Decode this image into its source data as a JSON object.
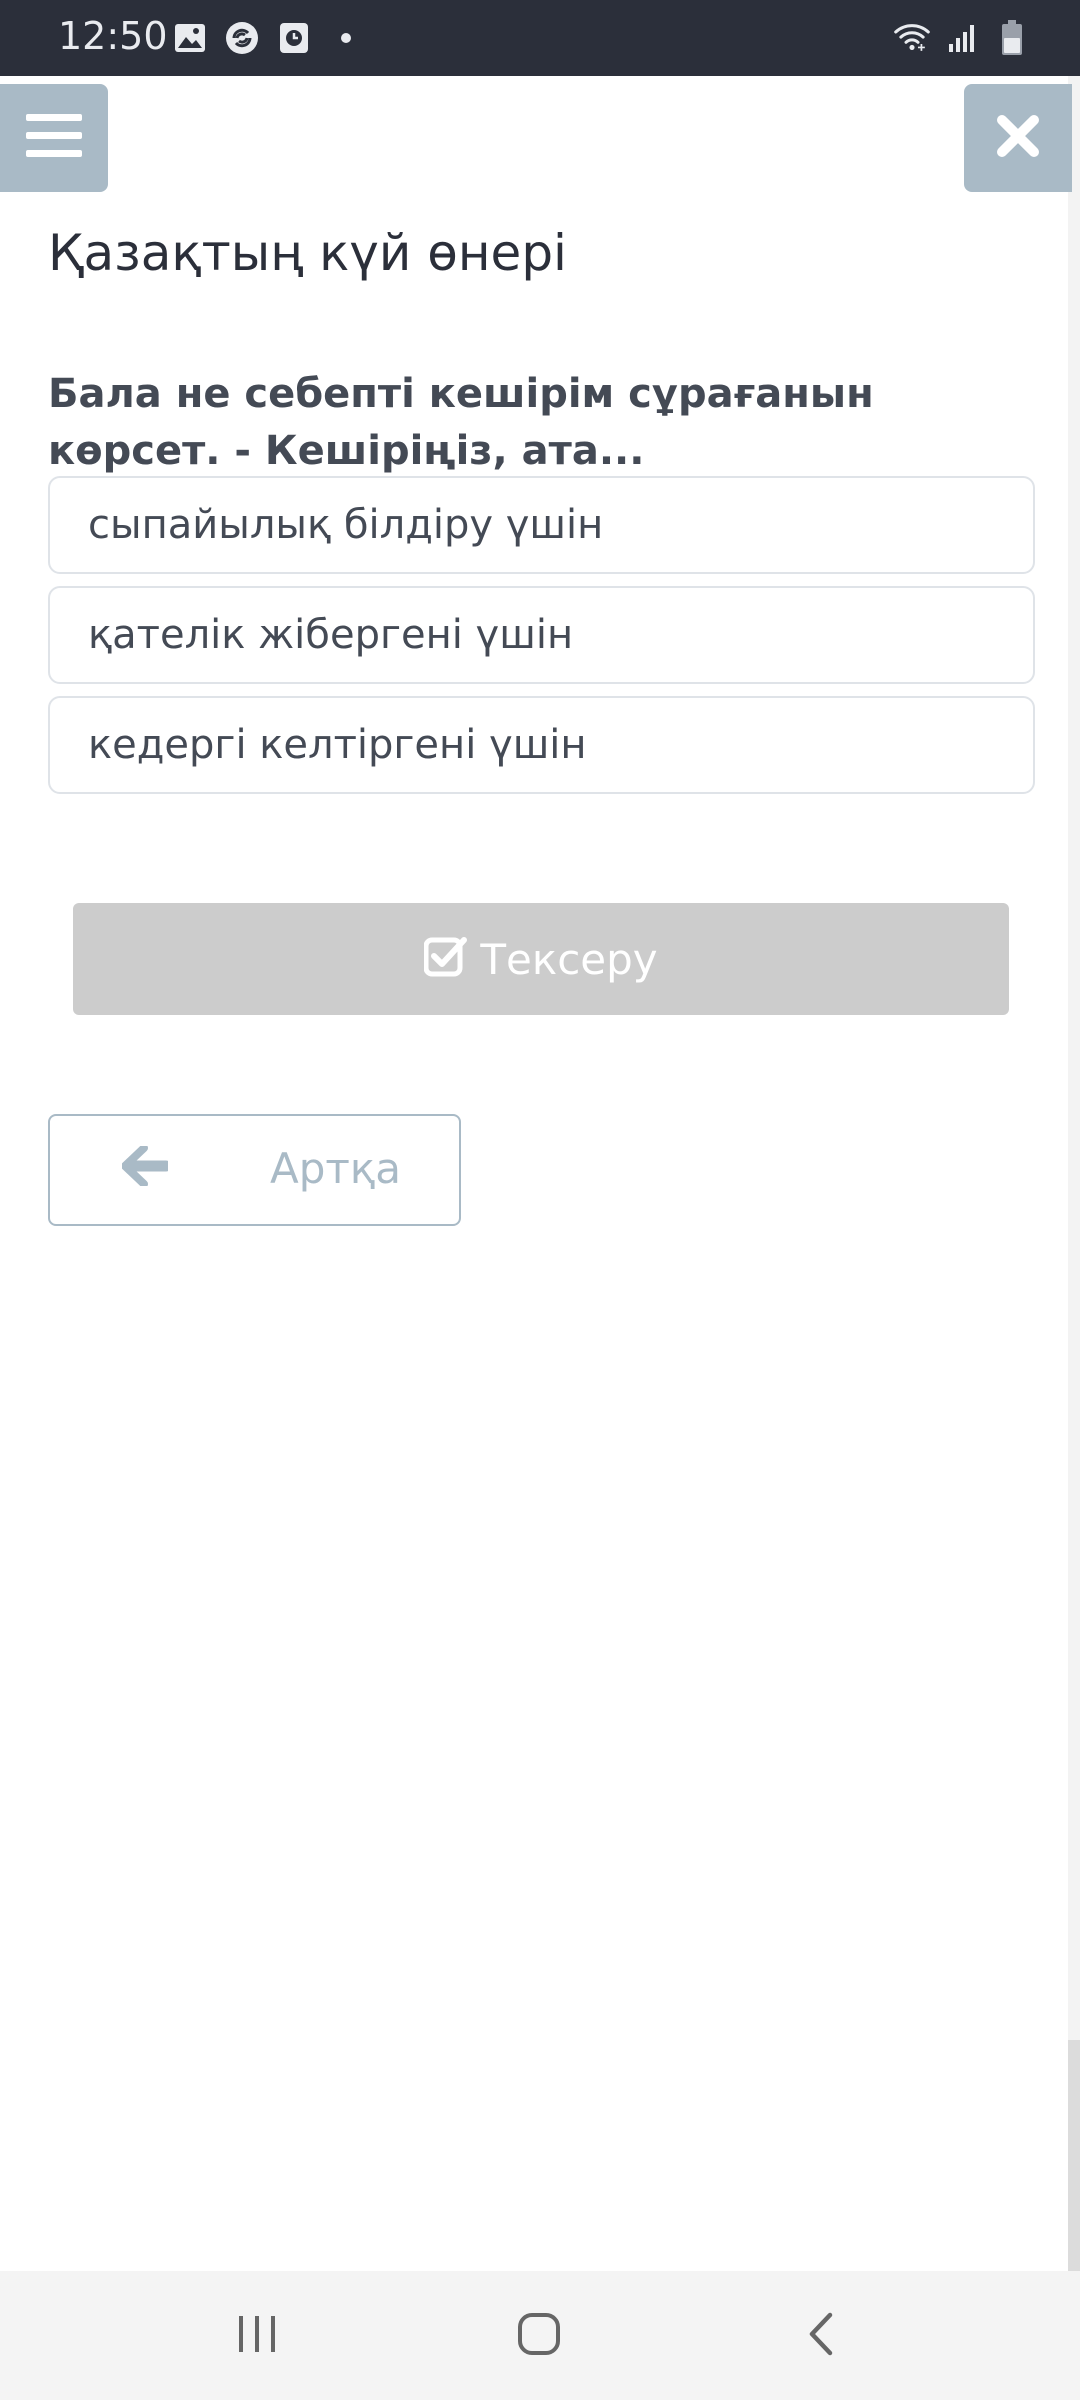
{
  "status_bar": {
    "time": "12:50",
    "left_icons": [
      "image-icon",
      "swirl-icon",
      "clock-square-icon",
      "dot-icon"
    ],
    "right_icons": [
      "wifi-icon",
      "signal-icon",
      "battery-icon"
    ]
  },
  "header": {
    "menu_icon": "hamburger-icon",
    "close_icon": "close-icon",
    "accent_color": "#a9bac6"
  },
  "page": {
    "title": "Қазақтың күй өнері"
  },
  "question": {
    "text": "Бала не себепті кешірім сұрағанын көрсет. - Кешіріңіз, ата...",
    "options": [
      "сыпайылық білдіру үшін",
      "қателік жібергені үшін",
      "кедергі келтіргені үшін"
    ]
  },
  "actions": {
    "check_label": "Тексеру",
    "check_icon": "checkbox-checked-icon",
    "check_button_color": "#cccccc",
    "back_label": "Артқа",
    "back_icon": "arrow-left-icon"
  },
  "nav_bar": {
    "buttons": [
      "recents-icon",
      "home-icon",
      "back-icon"
    ]
  }
}
